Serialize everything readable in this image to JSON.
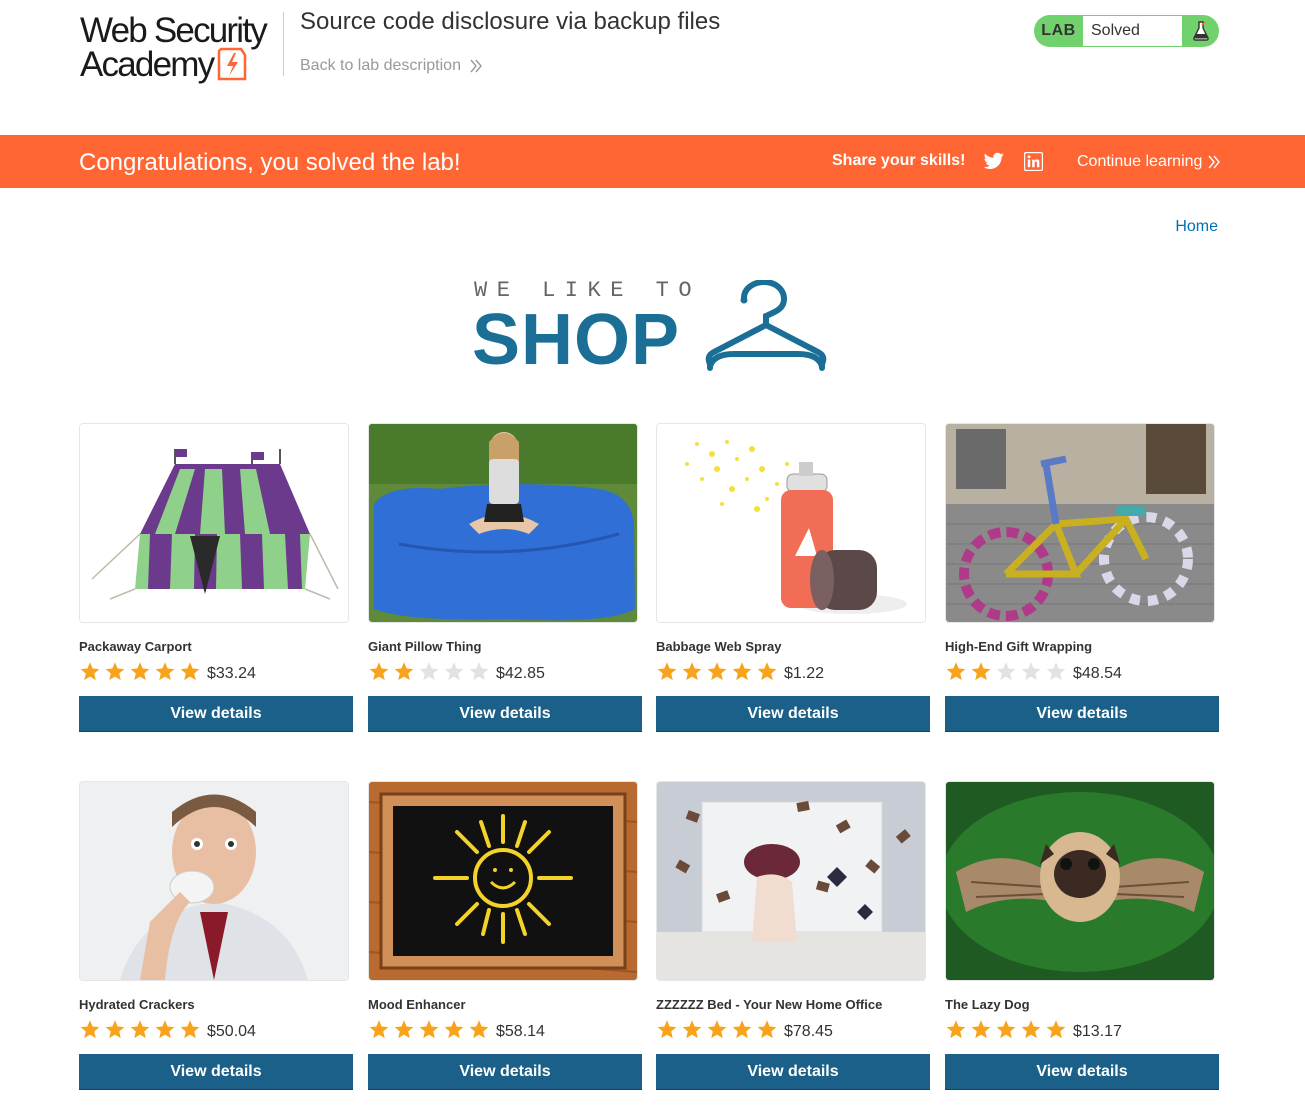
{
  "header": {
    "logo_line1": "Web Security",
    "logo_line2": "Academy",
    "lab_title": "Source code disclosure via backup files",
    "back_link": "Back to lab description",
    "lab_badge": "LAB",
    "lab_status": "Solved"
  },
  "banner": {
    "congrats": "Congratulations, you solved the lab!",
    "share": "Share your skills!",
    "continue": "Continue learning"
  },
  "nav": {
    "home": "Home"
  },
  "shop_logo": {
    "tagline": "WE LIKE TO",
    "word": "SHOP"
  },
  "colors": {
    "accent_orange": "#ff6633",
    "primary_blue": "#1b6088",
    "link_blue": "#0071bc",
    "solved_green": "#70d16d",
    "star_filled": "#f7a31b",
    "star_empty": "#e2e2e2"
  },
  "products": [
    {
      "name": "Packaway Carport",
      "rating": 5,
      "price": "$33.24",
      "button": "View details",
      "image": "tent"
    },
    {
      "name": "Giant Pillow Thing",
      "rating": 2,
      "price": "$42.85",
      "button": "View details",
      "image": "pillow"
    },
    {
      "name": "Babbage Web Spray",
      "rating": 5,
      "price": "$1.22",
      "button": "View details",
      "image": "spray"
    },
    {
      "name": "High-End Gift Wrapping",
      "rating": 2,
      "price": "$48.54",
      "button": "View details",
      "image": "bicycle"
    },
    {
      "name": "Hydrated Crackers",
      "rating": 5,
      "price": "$50.04",
      "button": "View details",
      "image": "man-eating"
    },
    {
      "name": "Mood Enhancer",
      "rating": 5,
      "price": "$58.14",
      "button": "View details",
      "image": "chalkboard-sun"
    },
    {
      "name": "ZZZZZZ Bed - Your New Home Office",
      "rating": 5,
      "price": "$78.45",
      "button": "View details",
      "image": "flying-books"
    },
    {
      "name": "The Lazy Dog",
      "rating": 5,
      "price": "$13.17",
      "button": "View details",
      "image": "flying-pug"
    }
  ]
}
